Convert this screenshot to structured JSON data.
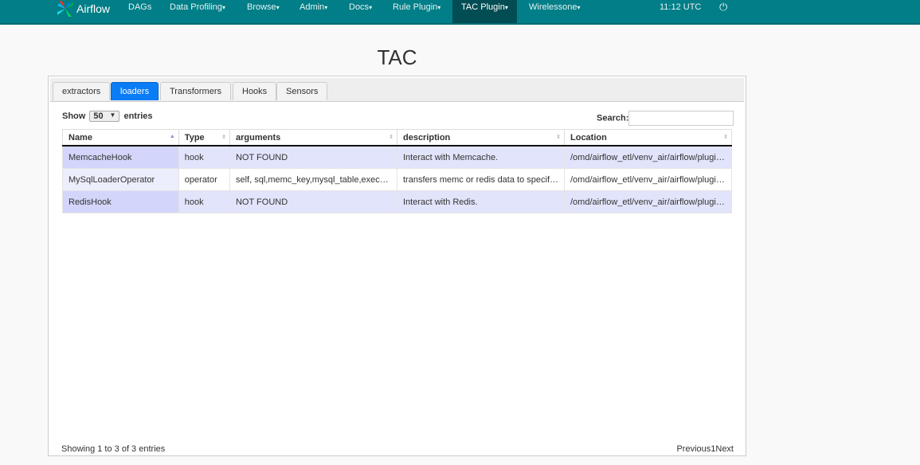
{
  "nav": {
    "brand": "Airflow",
    "items": [
      {
        "label": "DAGs",
        "dropdown": false
      },
      {
        "label": "Data Profiling",
        "dropdown": true
      },
      {
        "label": "Browse",
        "dropdown": true
      },
      {
        "label": "Admin",
        "dropdown": true
      },
      {
        "label": "Docs",
        "dropdown": true
      },
      {
        "label": "Rule Plugin",
        "dropdown": true
      },
      {
        "label": "TAC Plugin",
        "dropdown": true,
        "active": true
      },
      {
        "label": "Wirelessone",
        "dropdown": true
      }
    ],
    "time": "11:12 UTC"
  },
  "page": {
    "title": "TAC"
  },
  "tabs": [
    "extractors",
    "loaders",
    "Transformers",
    "Hooks",
    "Sensors"
  ],
  "active_tab": "loaders",
  "table": {
    "show_label": "Show",
    "entries_value": "50",
    "entries_label": "entries",
    "search_label": "Search:",
    "search_value": "",
    "columns": [
      "Name",
      "Type",
      "arguments",
      "description",
      "Location"
    ],
    "rows": [
      [
        "MemcacheHook",
        "hook",
        "NOT FOUND",
        "Interact with Memcache.",
        "/omd/airflow_etl/venv_air/airflow/plugin…"
      ],
      [
        "MySqlLoaderOperator",
        "operator",
        "self, sql,memc_key,mysql_table,exec_…",
        "transfers memc or redis data to specif…",
        "/omd/airflow_etl/venv_air/airflow/plugin…"
      ],
      [
        "RedisHook",
        "hook",
        "NOT FOUND",
        "Interact with Redis.",
        "/omd/airflow_etl/venv_air/airflow/plugin…"
      ]
    ]
  },
  "footer": {
    "info": "Showing 1 to 3 of 3 entries",
    "previous": "Previous",
    "page": "1",
    "next": "Next"
  }
}
